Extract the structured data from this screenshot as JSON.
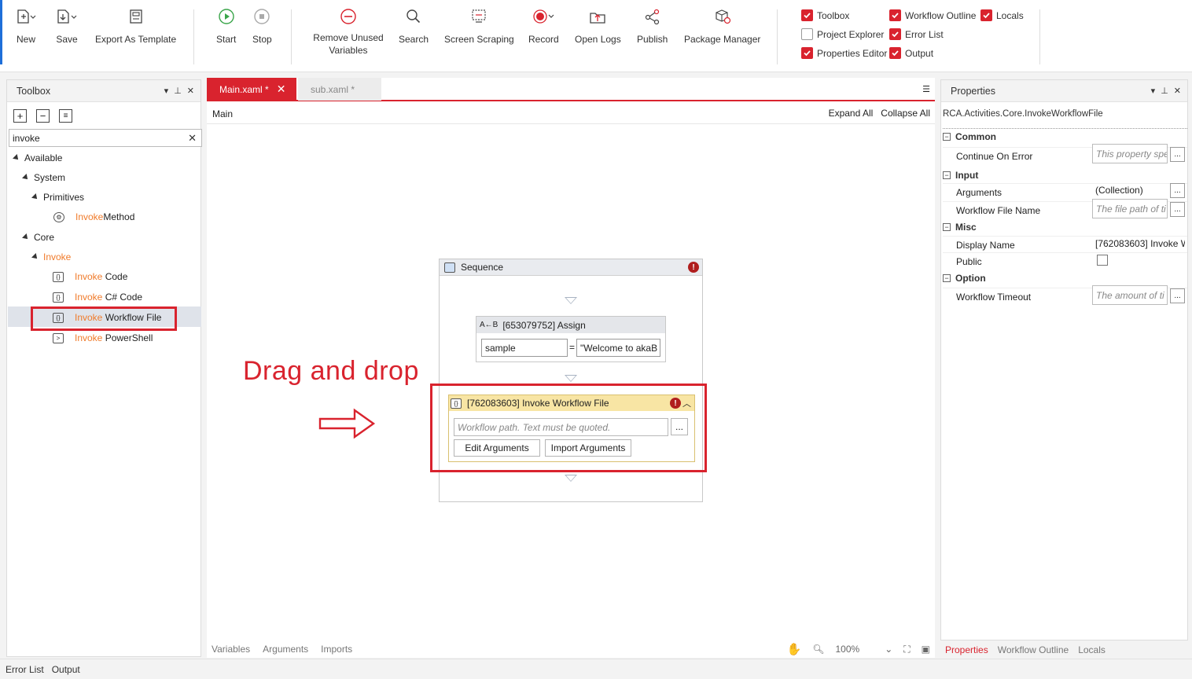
{
  "ribbon": {
    "new": "New",
    "save": "Save",
    "export_template": "Export As Template",
    "start": "Start",
    "stop": "Stop",
    "remove_unused": "Remove Unused Variables",
    "search": "Search",
    "screen_scraping": "Screen Scraping",
    "record": "Record",
    "open_logs": "Open Logs",
    "publish": "Publish",
    "package_manager": "Package Manager",
    "toggles": {
      "toolbox": "Toolbox",
      "project_explorer": "Project Explorer",
      "properties_editor": "Properties Editor",
      "workflow_outline": "Workflow Outline",
      "error_list": "Error List",
      "output": "Output",
      "locals": "Locals"
    },
    "toggle_state": {
      "toolbox": true,
      "project_explorer": false,
      "properties_editor": true,
      "workflow_outline": true,
      "error_list": true,
      "output": true,
      "locals": true
    }
  },
  "toolbox": {
    "title": "Toolbox",
    "search_value": "invoke",
    "tree": {
      "available": "Available",
      "system": "System",
      "primitives": "Primitives",
      "invoke_method_hl": "Invoke",
      "invoke_method_rest": "Method",
      "core": "Core",
      "invoke_group": "Invoke",
      "invoke_hl": "Invoke",
      "code_rest": " Code",
      "csharp_rest": " C# Code",
      "workflow_rest": " Workflow File",
      "powershell_rest": " PowerShell"
    }
  },
  "designer": {
    "tab_main": "Main.xaml *",
    "tab_sub": "sub.xaml *",
    "breadcrumb": "Main",
    "expand_all": "Expand All",
    "collapse_all": "Collapse All",
    "sequence_title": "Sequence",
    "assign_title": "[653079752] Assign",
    "assign_to": "sample",
    "assign_eq": "=",
    "assign_value": "\"Welcome to akaB",
    "invoke_title": "[762083603] Invoke Workflow File",
    "invoke_placeholder": "Workflow path. Text must be quoted.",
    "browse": "...",
    "edit_arguments": "Edit Arguments",
    "import_arguments": "Import Arguments",
    "drag_text": "Drag and drop",
    "bottom_tabs": [
      "Variables",
      "Arguments",
      "Imports"
    ],
    "zoom": "100%"
  },
  "properties": {
    "title": "Properties",
    "type": "RCA.Activities.Core.InvokeWorkflowFile",
    "cat_common": "Common",
    "continue_on_error": "Continue On Error",
    "continue_on_error_ph": "This property spe",
    "cat_input": "Input",
    "arguments": "Arguments",
    "arguments_val": "(Collection)",
    "workflow_file_name": "Workflow File Name",
    "workflow_file_name_ph": "The file path of ti",
    "cat_misc": "Misc",
    "display_name": "Display Name",
    "display_name_val": "[762083603] Invoke W",
    "public": "Public",
    "cat_option": "Option",
    "workflow_timeout": "Workflow Timeout",
    "workflow_timeout_ph": "The amount of ti",
    "bottom_tabs": [
      "Properties",
      "Workflow Outline",
      "Locals"
    ]
  },
  "bottom": {
    "error_list": "Error List",
    "output": "Output"
  },
  "colors": {
    "accent": "#d9232e",
    "highlight": "#f07b2b",
    "invoke_header": "#f8e5a4"
  }
}
